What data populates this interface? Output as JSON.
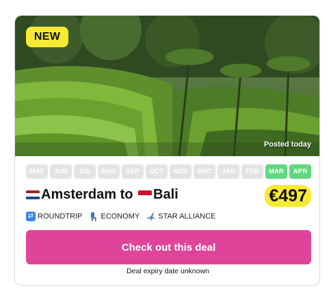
{
  "badge": "NEW",
  "posted": "Posted today",
  "months": [
    {
      "label": "MAY",
      "active": false
    },
    {
      "label": "JUN",
      "active": false
    },
    {
      "label": "JUL",
      "active": false
    },
    {
      "label": "AUG",
      "active": false
    },
    {
      "label": "SEP",
      "active": false
    },
    {
      "label": "OCT",
      "active": false
    },
    {
      "label": "NOV",
      "active": false
    },
    {
      "label": "DEC",
      "active": false
    },
    {
      "label": "JAN",
      "active": false
    },
    {
      "label": "FEB",
      "active": false
    },
    {
      "label": "MAR",
      "active": true
    },
    {
      "label": "APR",
      "active": true
    }
  ],
  "route": {
    "from": "Amsterdam",
    "connector": " to ",
    "to": "Bali",
    "from_flag_icon": "netherlands-flag-icon",
    "to_flag_icon": "indonesia-flag-icon"
  },
  "price": "€497",
  "meta": {
    "trip_type": "ROUNDTRIP",
    "cabin": "ECONOMY",
    "alliance": "STAR ALLIANCE"
  },
  "cta_label": "Check out this deal",
  "expiry": "Deal expiry date unknown",
  "colors": {
    "accent_pink": "#e0449a",
    "highlight_yellow": "#f7ea33",
    "month_active": "#5fd87e",
    "month_inactive": "#e4e4e4"
  }
}
